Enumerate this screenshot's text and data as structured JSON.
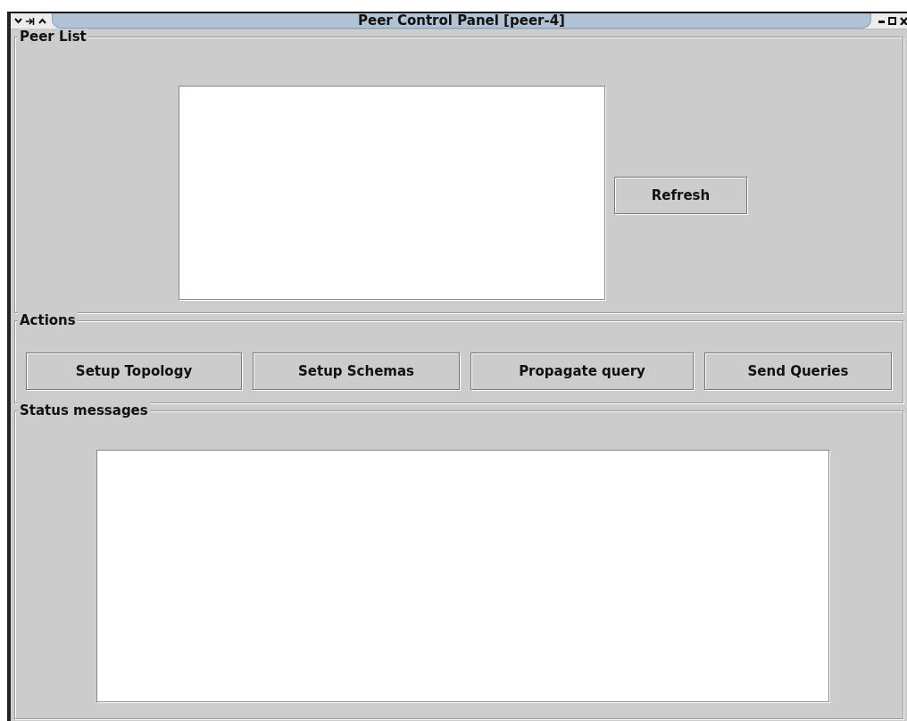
{
  "window": {
    "title": "Peer Control Panel [peer-4]"
  },
  "peer_list": {
    "title": "Peer List",
    "refresh_button": "Refresh"
  },
  "actions": {
    "title": "Actions",
    "buttons": [
      "Setup Topology",
      "Setup Schemas",
      "Propagate query",
      "Send Queries"
    ]
  },
  "status_messages": {
    "title": "Status messages"
  }
}
